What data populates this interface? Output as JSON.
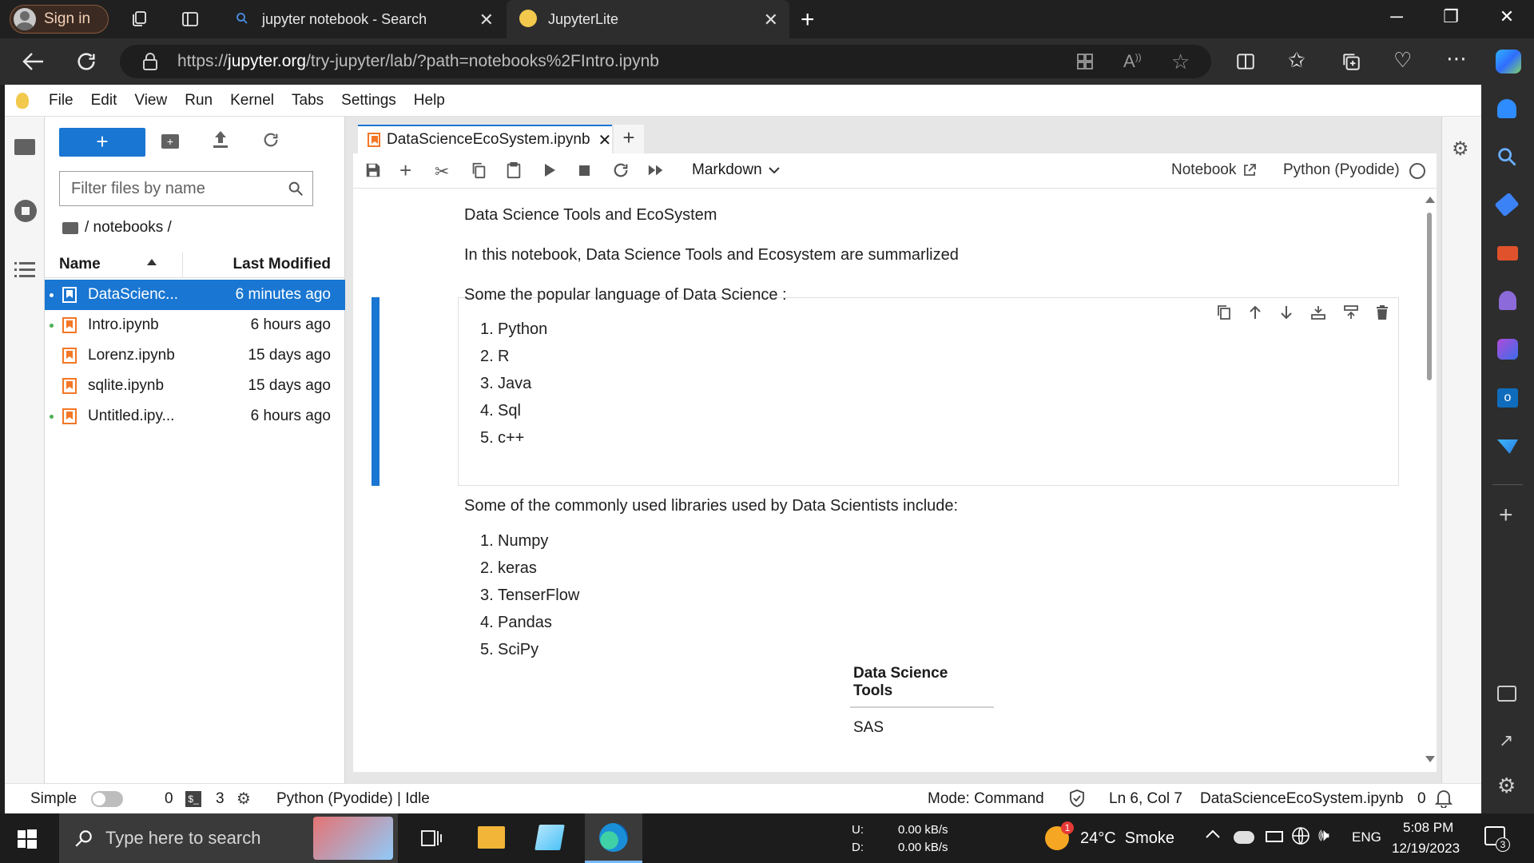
{
  "browser": {
    "sign_in": "Sign in",
    "tabs": [
      {
        "title": "jupyter notebook - Search"
      },
      {
        "title": "JupyterLite"
      }
    ],
    "url_prefix": "https://",
    "url_domain": "jupyter.org",
    "url_path": "/try-jupyter/lab/?path=notebooks%2FIntro.ipynb"
  },
  "menu": [
    "File",
    "Edit",
    "View",
    "Run",
    "Kernel",
    "Tabs",
    "Settings",
    "Help"
  ],
  "filebrowser": {
    "filter_placeholder": "Filter files by name",
    "path": "/ notebooks /",
    "col_name": "Name",
    "col_modified": "Last Modified",
    "files": [
      {
        "name": "DataScienc...",
        "modified": "6 minutes ago",
        "selected": true,
        "running": true
      },
      {
        "name": "Intro.ipynb",
        "modified": "6 hours ago",
        "selected": false,
        "running": true
      },
      {
        "name": "Lorenz.ipynb",
        "modified": "15 days ago",
        "selected": false,
        "running": false
      },
      {
        "name": "sqlite.ipynb",
        "modified": "15 days ago",
        "selected": false,
        "running": false
      },
      {
        "name": "Untitled.ipy...",
        "modified": "6 hours ago",
        "selected": false,
        "running": true
      }
    ]
  },
  "notebook": {
    "tab_title": "DataScienceEcoSystem.ipynb",
    "cell_type": "Markdown",
    "notebook_label": "Notebook",
    "kernel": "Python (Pyodide)",
    "cells": {
      "title": "Data Science Tools and EcoSystem",
      "intro": "In this notebook, Data Science Tools and Ecosystem are summarlized",
      "languages_heading": "Some the popular language of Data Science :",
      "languages": [
        "Python",
        "R",
        "Java",
        "Sql",
        "c++"
      ],
      "libraries_heading": "Some of the commonly used libraries used by Data Scientists include:",
      "libraries": [
        "Numpy",
        "keras",
        "TenserFlow",
        "Pandas",
        "SciPy"
      ],
      "table_header": "Data Science Tools",
      "table_first_row": "SAS"
    }
  },
  "statusbar": {
    "mode_simple": "Simple",
    "terminals": "0",
    "kernels": "3",
    "kernel_status": "Python (Pyodide) | Idle",
    "mode": "Mode: Command",
    "cursor": "Ln 6, Col 7",
    "filename": "DataScienceEcoSystem.ipynb",
    "notifications": "0"
  },
  "taskbar": {
    "search_placeholder": "Type here to search",
    "net_up_label": "U:",
    "net_down_label": "D:",
    "net_up": "0.00 kB/s",
    "net_down": "0.00 kB/s",
    "weather": "24°C  Smoke",
    "weather_badge": "1",
    "language": "ENG",
    "time": "5:08 PM",
    "date": "12/19/2023",
    "notif_count": "3"
  },
  "colors": {
    "accent": "#1976d2",
    "jupyter_orange": "#f37726"
  }
}
